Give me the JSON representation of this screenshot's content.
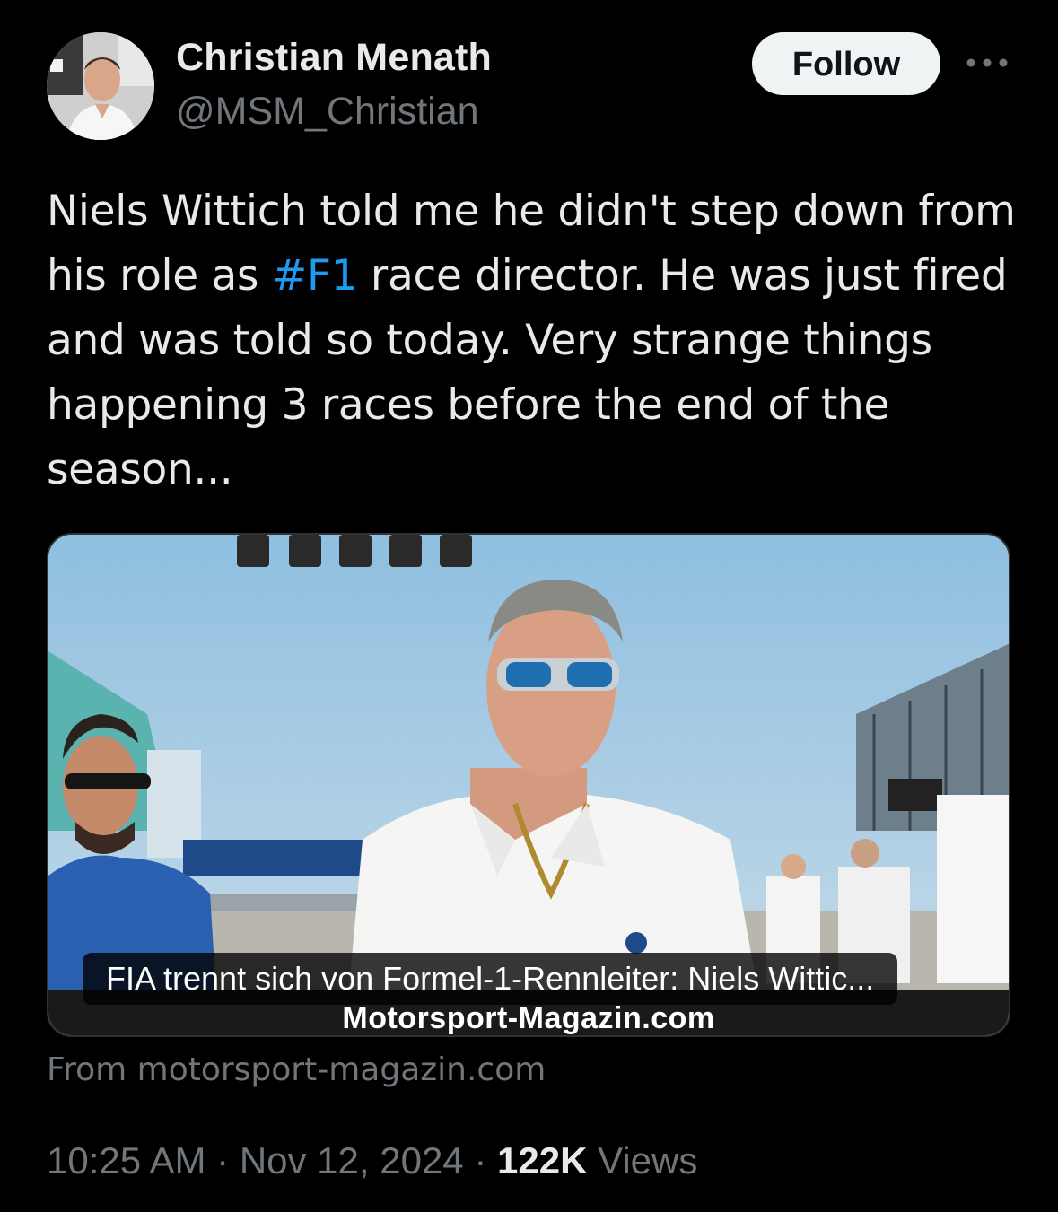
{
  "author": {
    "name": "Christian Menath",
    "handle": "@MSM_Christian"
  },
  "follow_label": "Follow",
  "tweet": {
    "text_before_hashtag": "Niels Wittich told me he didn't step down from his role as ",
    "hashtag": "#F1",
    "text_after_hashtag": " race director. He was just fired and was told so today. Very strange things happening 3 races before the end of the season..."
  },
  "link_card": {
    "title": "FIA trennt sich von Formel-1-Rennleiter: Niels Wittic...",
    "watermark": "Motorsport-Magazin.com",
    "source": "From motorsport-magazin.com"
  },
  "meta": {
    "time": "10:25 AM",
    "separator": "·",
    "date": "Nov 12, 2024",
    "views_count": "122K",
    "views_label": "Views"
  },
  "icons": {
    "more": "more-horizontal-icon"
  },
  "colors": {
    "background": "#000000",
    "text": "#e7e9ea",
    "secondary": "#71767b",
    "accent": "#1d9bf0",
    "button_bg": "#eff3f4"
  }
}
